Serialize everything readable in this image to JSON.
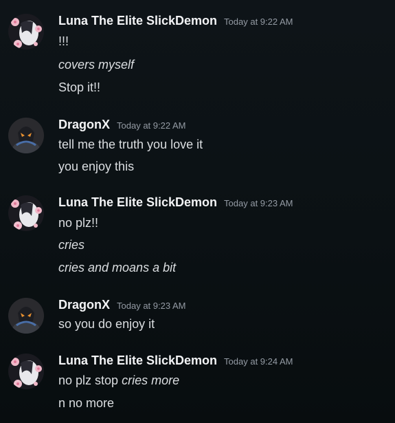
{
  "messages": [
    {
      "author": "Luna  The Elite SlickDemon",
      "time": "Today at 9:22 AM",
      "avatar_icon": "luna-cherry-blossom-avatar",
      "lines": [
        "!!!",
        "covers myself",
        "Stop it!!"
      ]
    },
    {
      "author": "DragonX",
      "time": "Today at 9:22 AM",
      "avatar_icon": "dragonx-armored-avatar",
      "lines": [
        "tell me the truth you love it",
        "you enjoy this"
      ]
    },
    {
      "author": "Luna  The Elite SlickDemon",
      "time": "Today at 9:23 AM",
      "avatar_icon": "luna-cherry-blossom-avatar",
      "lines": [
        "no plz!!",
        "cries",
        "cries and moans a bit"
      ]
    },
    {
      "author": "DragonX",
      "time": "Today at 9:23 AM",
      "avatar_icon": "dragonx-armored-avatar",
      "lines": [
        "so you do enjoy it"
      ]
    },
    {
      "author": "Luna  The Elite SlickDemon",
      "time": "Today at 9:24 AM",
      "avatar_icon": "luna-cherry-blossom-avatar",
      "lines": [
        "no plz stop",
        "cries more",
        "n no more"
      ]
    }
  ],
  "colors": {
    "background": "#0b1114",
    "username": "#f2f3f5",
    "timestamp": "#949ba4",
    "text": "#dbdee1"
  }
}
